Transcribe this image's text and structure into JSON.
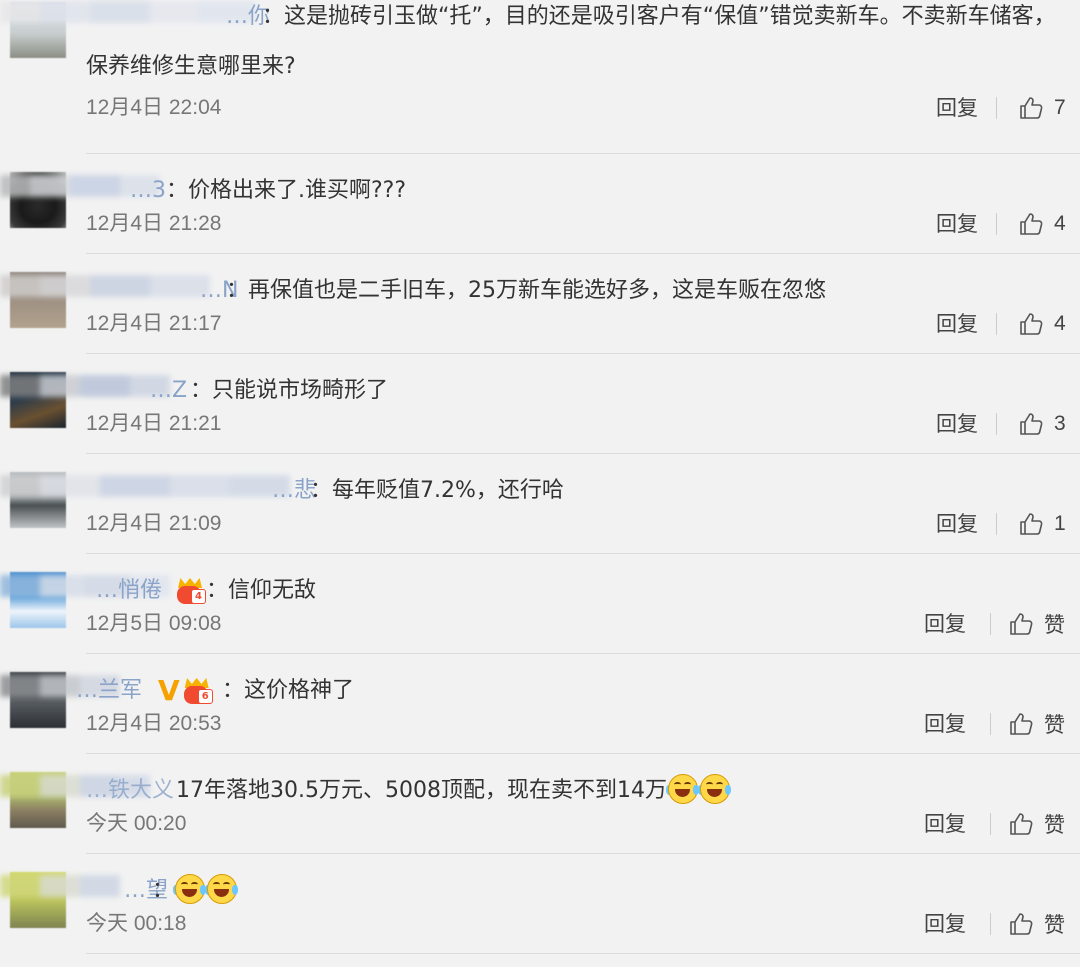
{
  "comments": [
    {
      "username": "…你",
      "text": "：这是抛砖引玉做“托”，目的还是吸引客户有“保值”错觉卖新车。不卖新车储客，",
      "text2": "保养维修生意哪里来?",
      "time": "12月4日 22:04",
      "reply": "回复",
      "likes": "7"
    },
    {
      "username": "…3",
      "text": "：价格出来了.谁买啊???",
      "time": "12月4日 21:28",
      "reply": "回复",
      "likes": "4"
    },
    {
      "username": "…N",
      "text": "：再保值也是二手旧车，25万新车能选好多，这是车贩在忽悠",
      "time": "12月4日 21:17",
      "reply": "回复",
      "likes": "4"
    },
    {
      "username": "…Z",
      "text": "：只能说市场畸形了",
      "time": "12月4日 21:21",
      "reply": "回复",
      "likes": "3"
    },
    {
      "username": "…悲",
      "text": "：每年贬值7.2%，还行哈",
      "time": "12月4日 21:09",
      "reply": "回复",
      "likes": "1"
    },
    {
      "username": "…悄倦",
      "badge_level": "4",
      "text": "：信仰无敌",
      "time": "12月5日 09:08",
      "reply": "回复",
      "likes": "赞"
    },
    {
      "username": "…兰军",
      "badge_v": "V",
      "badge_level": "6",
      "text": "：这价格神了",
      "time": "12月4日 20:53",
      "reply": "回复",
      "likes": "赞"
    },
    {
      "username": "…铁大义",
      "text": "17年落地30.5万元、5008顶配，现在卖不到14万",
      "emoji": "laugh-cry-emoji",
      "time": "今天 00:20",
      "reply": "回复",
      "likes": "赞"
    },
    {
      "username": "…望",
      "text": "：",
      "emoji": "laugh-cry-emoji",
      "time": "今天 00:18",
      "reply": "回复",
      "likes": "赞"
    }
  ],
  "colors": {
    "background": "#f2f2f2",
    "username": "#5b7db8",
    "text": "#333333",
    "time": "#777777",
    "divider": "#dcdcdc"
  }
}
